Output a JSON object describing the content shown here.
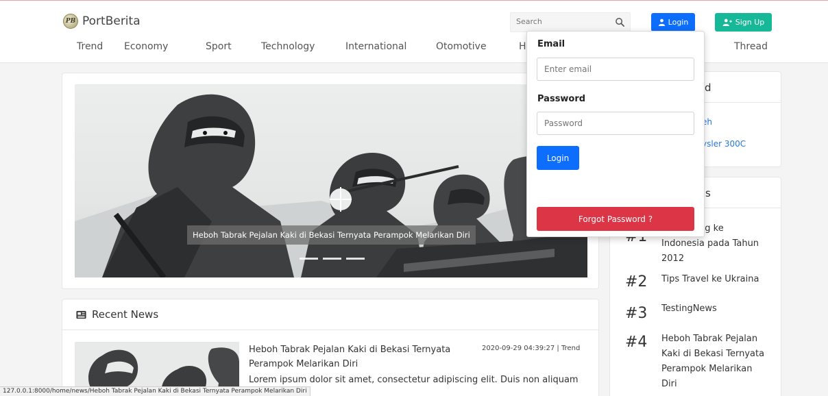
{
  "brand": {
    "name": "PortBerita",
    "logo_text": "PB"
  },
  "nav": {
    "items": [
      {
        "label": "Trend"
      },
      {
        "label": "Economy"
      },
      {
        "label": "Sport"
      },
      {
        "label": "Technology"
      },
      {
        "label": "International"
      },
      {
        "label": "Otomotive"
      },
      {
        "label": "H"
      },
      {
        "label": "Thread"
      }
    ]
  },
  "search": {
    "placeholder": "Search",
    "icon": "search-icon"
  },
  "auth": {
    "login_label": "Login",
    "signup_label": "Sign Up"
  },
  "carousel": {
    "caption": "Heboh Tabrak Pejalan Kaki di Bekasi Ternyata Perampok Melarikan Diri",
    "slide_count": 3
  },
  "recent": {
    "title": "Recent News",
    "items": [
      {
        "title": "Heboh Tabrak Pejalan Kaki di Bekasi Ternyata Perampok Melarikan Diri",
        "datetime": "2020-09-29 04:39:27",
        "category": "Trend",
        "meta_separator": "|",
        "excerpt": "Lorem ipsum dolor sit amet, consectetur adipiscing elit. Duis non aliquam"
      }
    ]
  },
  "sidebar": {
    "card1": {
      "title_fragment": "d",
      "links": [
        {
          "label": "eh"
        },
        {
          "label": "ysler 300C"
        }
      ]
    },
    "card2": {
      "title_fragment": "s",
      "items": [
        {
          "rank": "#1",
          "title": "per datang ke Indonesia pada Tahun 2012",
          "title_line1": "per datang ke",
          "title_line2": "Indonesia pada Tahun",
          "title_line3": "2012"
        },
        {
          "rank": "#2",
          "title": "Tips Travel ke Ukraina"
        },
        {
          "rank": "#3",
          "title": "TestingNews"
        },
        {
          "rank": "#4",
          "title_line1": "Heboh Tabrak Pejalan",
          "title_line2": "Kaki di Bekasi Ternyata",
          "title_line3": "Perampok Melarikan",
          "title_line4": "Diri"
        }
      ]
    }
  },
  "login_dropdown": {
    "email_label": "Email",
    "email_placeholder": "Enter email",
    "password_label": "Password",
    "password_placeholder": "Password",
    "submit_label": "Login",
    "forgot_label": "Forgot Password ?"
  },
  "status_url": "127.0.0.1:8000/home/news/Heboh Tabrak Pejalan Kaki di Bekasi Ternyata Perampok Melarikan Diri",
  "colors": {
    "primary": "#0d6efd",
    "success": "#17b897",
    "danger": "#dc3545",
    "link": "#2677d9"
  }
}
